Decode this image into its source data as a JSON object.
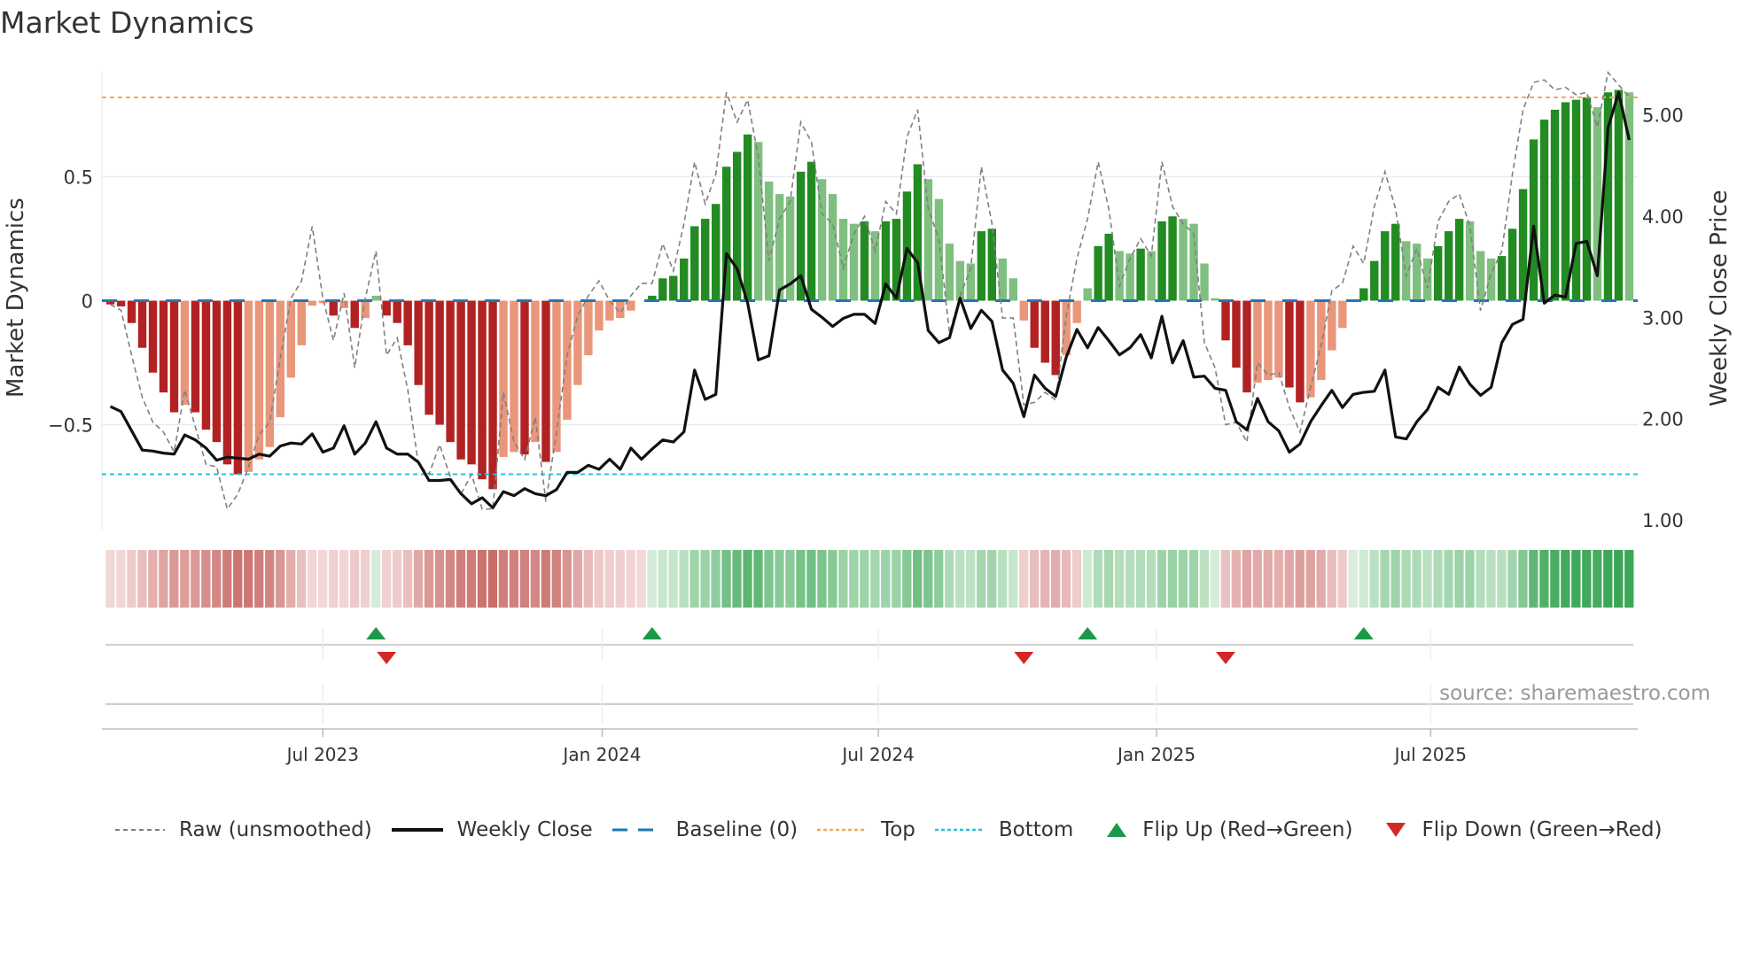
{
  "title": "Market Dynamics",
  "source": "source: sharemaestro.com",
  "chart_data": {
    "type": "bar",
    "title": "Market Dynamics",
    "ylabel": "Market Dynamics",
    "y2label": "Weekly Close Price",
    "ylim": [
      -0.923,
      0.923
    ],
    "y2lim": [
      0.905,
      5.424
    ],
    "xlim": [
      -0.8,
      143.8
    ],
    "x_unit": "week index",
    "left_ticks": [
      {
        "label": "0.5",
        "value": 0.5
      },
      {
        "label": "0",
        "value": 0
      },
      {
        "label": "−0.5",
        "value": -0.5
      }
    ],
    "right_ticks": [
      {
        "label": "5.00",
        "value": 5
      },
      {
        "label": "4.00",
        "value": 4
      },
      {
        "label": "3.00",
        "value": 3
      },
      {
        "label": "2.00",
        "value": 2
      },
      {
        "label": "1.00",
        "value": 1
      }
    ],
    "x_ticks": [
      {
        "label": "Jul 2023",
        "week": 20.0
      },
      {
        "label": "Jan 2024",
        "week": 46.3
      },
      {
        "label": "Jul 2024",
        "week": 72.3
      },
      {
        "label": "Jan 2025",
        "week": 98.5
      },
      {
        "label": "Jul 2025",
        "week": 124.3
      }
    ],
    "baseline": 0,
    "top_level": 0.82,
    "bottom_level": -0.7,
    "momentum": [
      -0.015,
      -0.023,
      -0.09,
      -0.19,
      -0.29,
      -0.37,
      -0.45,
      -0.42,
      -0.45,
      -0.52,
      -0.57,
      -0.66,
      -0.7,
      -0.69,
      -0.64,
      -0.59,
      -0.47,
      -0.31,
      -0.18,
      -0.02,
      -0.01,
      -0.06,
      -0.03,
      -0.11,
      -0.07,
      0.02,
      -0.06,
      -0.09,
      -0.18,
      -0.34,
      -0.46,
      -0.5,
      -0.57,
      -0.64,
      -0.66,
      -0.72,
      -0.76,
      -0.63,
      -0.61,
      -0.62,
      -0.57,
      -0.65,
      -0.61,
      -0.48,
      -0.34,
      -0.22,
      -0.12,
      -0.08,
      -0.07,
      -0.04,
      -0.005,
      0.02,
      0.09,
      0.1,
      0.17,
      0.3,
      0.33,
      0.39,
      0.54,
      0.6,
      0.67,
      0.64,
      0.48,
      0.43,
      0.42,
      0.52,
      0.56,
      0.49,
      0.43,
      0.33,
      0.31,
      0.32,
      0.28,
      0.32,
      0.33,
      0.44,
      0.55,
      0.49,
      0.41,
      0.23,
      0.16,
      0.15,
      0.28,
      0.29,
      0.17,
      0.09,
      -0.08,
      -0.19,
      -0.25,
      -0.3,
      -0.22,
      -0.09,
      0.05,
      0.22,
      0.27,
      0.2,
      0.19,
      0.21,
      0.2,
      0.32,
      0.34,
      0.33,
      0.31,
      0.15,
      0.01,
      -0.16,
      -0.27,
      -0.37,
      -0.33,
      -0.32,
      -0.31,
      -0.35,
      -0.41,
      -0.39,
      -0.32,
      -0.2,
      -0.11,
      0.0,
      0.05,
      0.16,
      0.28,
      0.31,
      0.24,
      0.23,
      0.17,
      0.22,
      0.28,
      0.33,
      0.32,
      0.2,
      0.17,
      0.18,
      0.29,
      0.45,
      0.65,
      0.73,
      0.77,
      0.8,
      0.81,
      0.82,
      0.78,
      0.84,
      0.85,
      0.84
    ],
    "raw": [
      -0.015,
      -0.039,
      -0.22,
      -0.39,
      -0.49,
      -0.53,
      -0.61,
      -0.36,
      -0.51,
      -0.66,
      -0.67,
      -0.84,
      -0.78,
      -0.67,
      -0.54,
      -0.49,
      -0.23,
      0.01,
      0.08,
      0.3,
      0.01,
      -0.16,
      0.03,
      -0.27,
      0.01,
      0.2,
      -0.22,
      -0.15,
      -0.36,
      -0.66,
      -0.7,
      -0.58,
      -0.71,
      -0.78,
      -0.7,
      -0.84,
      -0.84,
      -0.37,
      -0.57,
      -0.64,
      -0.47,
      -0.81,
      -0.53,
      -0.22,
      -0.06,
      0.02,
      0.08,
      0.0,
      -0.05,
      0.02,
      0.07,
      0.07,
      0.23,
      0.12,
      0.31,
      0.56,
      0.39,
      0.51,
      0.84,
      0.72,
      0.81,
      0.58,
      0.16,
      0.33,
      0.4,
      0.72,
      0.64,
      0.35,
      0.31,
      0.13,
      0.27,
      0.34,
      0.2,
      0.4,
      0.35,
      0.66,
      0.77,
      0.37,
      0.25,
      -0.13,
      0.02,
      0.13,
      0.54,
      0.31,
      -0.07,
      -0.07,
      -0.42,
      -0.41,
      -0.37,
      -0.4,
      -0.06,
      0.17,
      0.33,
      0.56,
      0.37,
      0.06,
      0.17,
      0.25,
      0.18,
      0.56,
      0.38,
      0.31,
      0.27,
      -0.17,
      -0.27,
      -0.5,
      -0.49,
      -0.57,
      -0.25,
      -0.3,
      -0.29,
      -0.43,
      -0.53,
      -0.35,
      -0.18,
      0.04,
      0.07,
      0.22,
      0.15,
      0.38,
      0.52,
      0.37,
      0.1,
      0.21,
      0.05,
      0.32,
      0.4,
      0.43,
      0.3,
      -0.04,
      0.11,
      0.2,
      0.51,
      0.77,
      0.88,
      0.89,
      0.85,
      0.86,
      0.83,
      0.84,
      0.7,
      0.92,
      0.87,
      0.82
    ],
    "weekly_close": [
      2.12,
      2.07,
      1.88,
      1.69,
      1.68,
      1.66,
      1.65,
      1.84,
      1.79,
      1.71,
      1.59,
      1.62,
      1.61,
      1.6,
      1.65,
      1.63,
      1.73,
      1.76,
      1.75,
      1.85,
      1.67,
      1.71,
      1.93,
      1.65,
      1.76,
      1.97,
      1.71,
      1.65,
      1.65,
      1.57,
      1.39,
      1.39,
      1.4,
      1.26,
      1.16,
      1.22,
      1.12,
      1.28,
      1.24,
      1.31,
      1.26,
      1.24,
      1.3,
      1.47,
      1.47,
      1.54,
      1.5,
      1.6,
      1.5,
      1.71,
      1.6,
      1.7,
      1.79,
      1.77,
      1.87,
      2.48,
      2.19,
      2.24,
      3.63,
      3.48,
      3.14,
      2.58,
      2.62,
      3.27,
      3.33,
      3.41,
      3.08,
      3.0,
      2.91,
      2.99,
      3.03,
      3.03,
      2.94,
      3.33,
      3.19,
      3.68,
      3.54,
      2.87,
      2.75,
      2.8,
      3.19,
      2.89,
      3.07,
      2.96,
      2.48,
      2.35,
      2.02,
      2.43,
      2.3,
      2.22,
      2.61,
      2.88,
      2.7,
      2.9,
      2.77,
      2.63,
      2.7,
      2.83,
      2.6,
      3.01,
      2.55,
      2.77,
      2.41,
      2.42,
      2.3,
      2.28,
      1.97,
      1.89,
      2.2,
      1.97,
      1.88,
      1.67,
      1.75,
      1.97,
      2.13,
      2.28,
      2.11,
      2.24,
      2.26,
      2.27,
      2.48,
      1.82,
      1.8,
      1.97,
      2.09,
      2.31,
      2.24,
      2.51,
      2.34,
      2.23,
      2.31,
      2.75,
      2.93,
      2.98,
      3.9,
      3.14,
      3.22,
      3.2,
      3.73,
      3.75,
      3.41,
      4.87,
      5.22,
      4.75
    ],
    "flips": {
      "up": [
        25,
        51,
        92,
        118
      ],
      "down": [
        26,
        86,
        105
      ]
    },
    "legend_position": "bottom",
    "legend": [
      {
        "key": "raw",
        "label": "Raw (unsmoothed)"
      },
      {
        "key": "close",
        "label": "Weekly Close"
      },
      {
        "key": "baseline",
        "label": "Baseline (0)"
      },
      {
        "key": "top",
        "label": "Top"
      },
      {
        "key": "bottom",
        "label": "Bottom"
      },
      {
        "key": "flip_up",
        "label": "Flip Up (Red→Green)"
      },
      {
        "key": "flip_down",
        "label": "Flip Down (Green→Red)"
      }
    ],
    "colors": {
      "neg_strong": "#b22222",
      "neg_weak": "#e9967a",
      "pos_strong": "#228b22",
      "pos_weak": "#7fbf7f",
      "raw": "#808080",
      "close": "#111111",
      "baseline": "#1f77b4",
      "top": "#f0a860",
      "bottom": "#22c4d8",
      "flip_up": "#1a9a48",
      "flip_down": "#d62728"
    }
  }
}
